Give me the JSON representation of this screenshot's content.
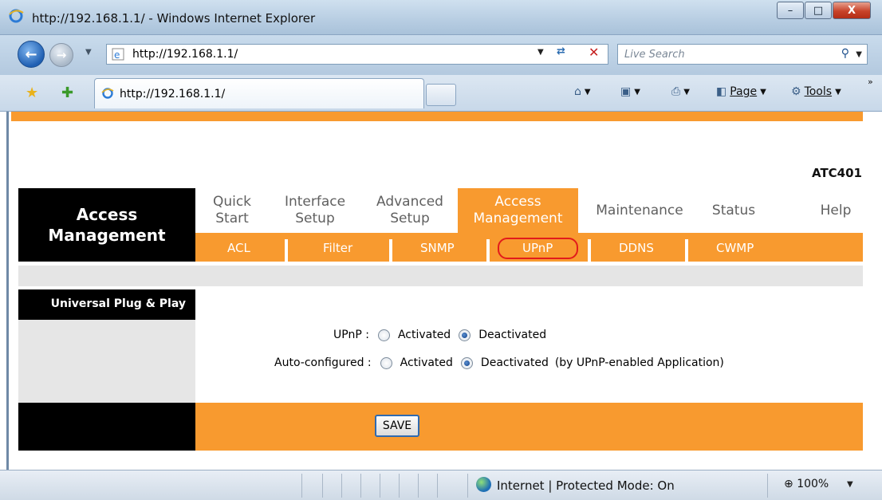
{
  "window": {
    "title": "http://192.168.1.1/ - Windows Internet Explorer",
    "minimize": "–",
    "maximize": "□",
    "close": "X"
  },
  "address_bar": {
    "url": "http://192.168.1.1/",
    "search_placeholder": "Live Search"
  },
  "tab": {
    "label": "http://192.168.1.1/"
  },
  "command_bar": {
    "page": "Page",
    "tools": "Tools"
  },
  "router": {
    "model": "ATC401",
    "section_title_line1": "Access",
    "section_title_line2": "Management",
    "menu": [
      {
        "line1": "Quick",
        "line2": "Start"
      },
      {
        "line1": "Interface",
        "line2": "Setup"
      },
      {
        "line1": "Advanced",
        "line2": "Setup"
      },
      {
        "line1": "Access",
        "line2": "Management"
      },
      {
        "line1": "Maintenance",
        "line2": ""
      },
      {
        "line1": "Status",
        "line2": ""
      },
      {
        "line1": "Help",
        "line2": ""
      }
    ],
    "submenu": [
      "ACL",
      "Filter",
      "SNMP",
      "UPnP",
      "DDNS",
      "CWMP"
    ],
    "panel_label": "Universal Plug & Play",
    "upnp": {
      "label": "UPnP :",
      "option_on": "Activated",
      "option_off": "Deactivated",
      "selected": "Deactivated"
    },
    "autoconfig": {
      "label": "Auto-configured :",
      "option_on": "Activated",
      "option_off": "Deactivated",
      "note": "(by UPnP-enabled Application)",
      "selected": "Deactivated"
    },
    "save_label": "SAVE"
  },
  "status_bar": {
    "zone": "Internet | Protected Mode: On",
    "zoom": "100%"
  },
  "colors": {
    "accent_orange": "#f89a2f",
    "highlight_red": "#e21b1b"
  }
}
